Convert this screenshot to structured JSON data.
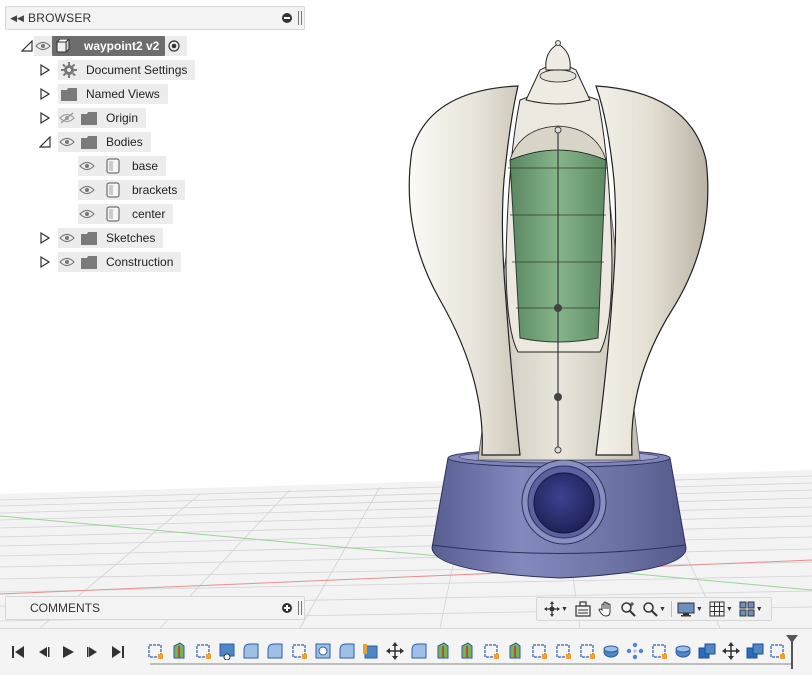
{
  "browser": {
    "title": "BROWSER",
    "root": {
      "label": "waypoint2 v2"
    },
    "items": [
      {
        "label": "Document Settings",
        "icon": "gear-icon"
      },
      {
        "label": "Named Views",
        "icon": "folder-icon"
      },
      {
        "label": "Origin",
        "icon": "folder-icon",
        "hidden": true
      },
      {
        "label": "Bodies",
        "icon": "folder-icon",
        "expanded": true
      },
      {
        "label": "base",
        "icon": "body-icon"
      },
      {
        "label": "brackets",
        "icon": "body-icon"
      },
      {
        "label": "center",
        "icon": "body-icon"
      },
      {
        "label": "Sketches",
        "icon": "folder-icon"
      },
      {
        "label": "Construction",
        "icon": "folder-icon"
      }
    ]
  },
  "comments": {
    "title": "COMMENTS"
  },
  "nav_toolbar": {
    "tools": [
      "orbit-icon",
      "look-at-icon",
      "pan-icon",
      "zoom-icon",
      "fit-icon",
      "display-settings-icon",
      "grid-icon",
      "viewports-icon"
    ]
  },
  "timeline": {
    "controls": [
      "skip-start-icon",
      "step-back-icon",
      "play-icon",
      "step-forward-icon",
      "skip-end-icon"
    ],
    "features": [
      "sketch",
      "extrude",
      "sketch",
      "hole",
      "fillet",
      "fillet",
      "sketch",
      "shell",
      "fillet",
      "extrude",
      "move",
      "fillet",
      "extrude",
      "extrude",
      "sketch",
      "extrude",
      "sketch",
      "sketch",
      "sketch",
      "revolve",
      "pattern",
      "sketch",
      "revolve",
      "combine",
      "move",
      "combine",
      "sketch"
    ]
  },
  "colors": {
    "shell": "#e6e1d6",
    "glass": "#74a57a",
    "base": "#6f74a6",
    "button": "#2d3170",
    "selected_row": "#6d6d6d",
    "row_chip": "#ececec"
  }
}
